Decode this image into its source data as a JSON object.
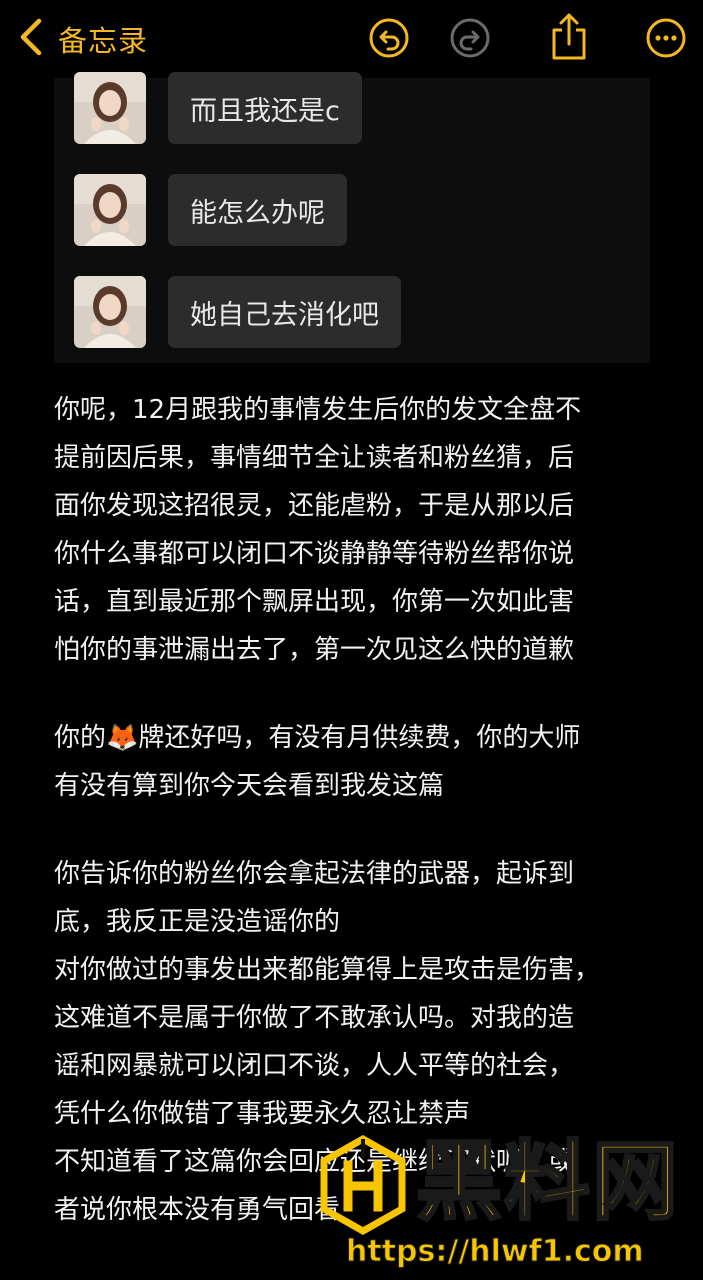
{
  "header": {
    "back_label": "备忘录",
    "accent_color": "#f5b825",
    "icons": [
      "chevron-left-icon",
      "undo-icon",
      "redo-icon",
      "share-icon",
      "more-icon"
    ]
  },
  "chat": {
    "messages": [
      {
        "text": "而且我还是c"
      },
      {
        "text": "能怎么办呢"
      },
      {
        "text": "她自己去消化吧"
      }
    ]
  },
  "note": {
    "paragraphs": [
      [
        "你呢，12月跟我的事情发生后你的发文全盘不",
        "提前因后果，事情细节全让读者和粉丝猜，后",
        "面你发现这招很灵，还能虐粉，于是从那以后",
        "你什么事都可以闭口不谈静静等待粉丝帮你说",
        "话，直到最近那个飘屏出现，你第一次如此害",
        "怕你的事泄漏出去了，第一次见这么快的道歉"
      ],
      [
        "你的🦊牌还好吗，有没有月供续费，你的大师",
        "有没有算到你今天会看到我发这篇"
      ],
      [
        "你告诉你的粉丝你会拿起法律的武器，起诉到",
        "底，我反正是没造谣你的",
        "对你做过的事发出来都能算得上是攻击是伤害，",
        "这难道不是属于你做了不敢承认吗。对我的造",
        "谣和网暴就可以闭口不谈，人人平等的社会，",
        "凭什么你做错了事我要永久忍让禁声",
        "不知道看了这篇你会回应还是继续沉默呢，或",
        "者说你根本没有勇气回看"
      ]
    ]
  },
  "watermark": {
    "brand": "黑料网",
    "url": "https://hlwf1.com",
    "color": "#f7c600"
  }
}
